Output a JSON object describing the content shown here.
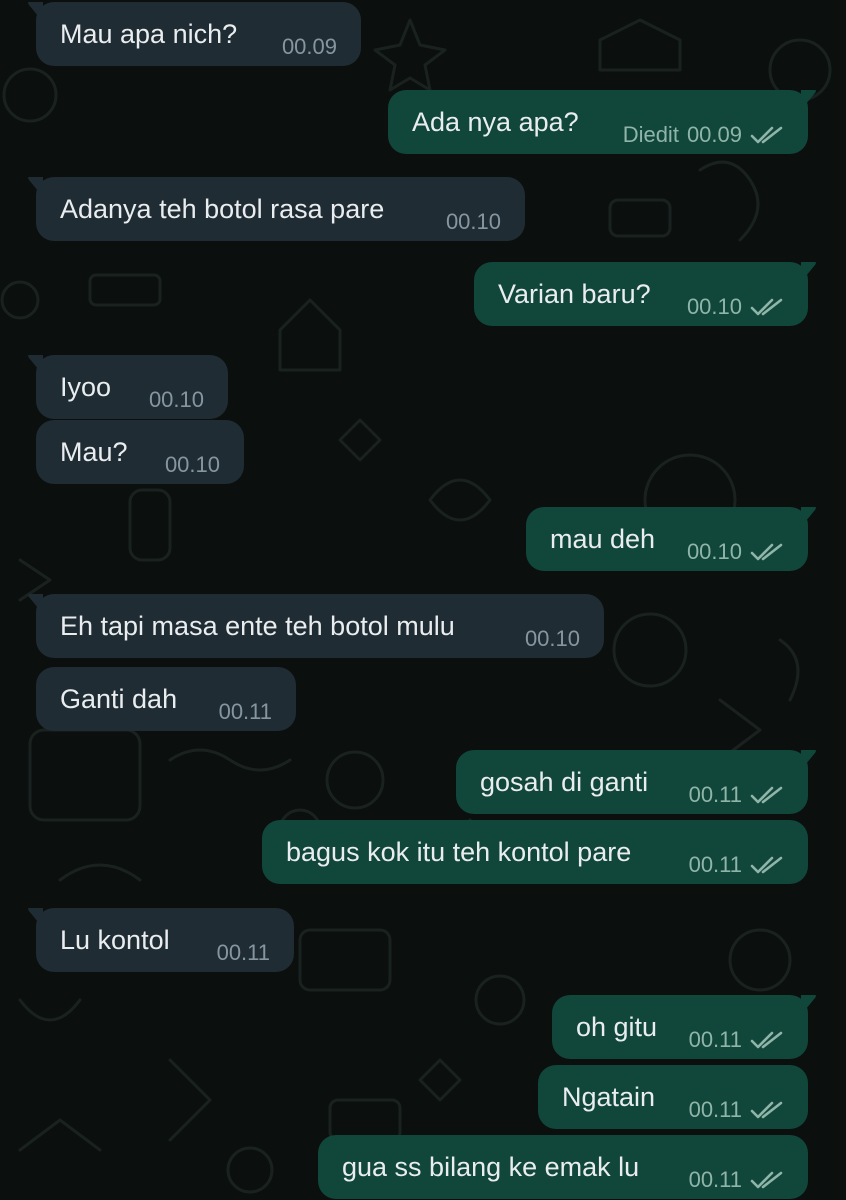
{
  "colors": {
    "background": "#0b0f0e",
    "incoming_bubble": "#202c33",
    "outgoing_bubble": "#11463a",
    "text": "#e9edef",
    "time_text": "#8696a0",
    "read_ticks": "#8fb5a8"
  },
  "icons": {
    "read_receipt": "double-check-icon"
  },
  "messages": [
    {
      "dir": "in",
      "text": "Mau apa nich?",
      "time": "00.09"
    },
    {
      "dir": "out",
      "text": "Ada nya apa?",
      "time": "00.09",
      "edited": "Diedit"
    },
    {
      "dir": "in",
      "text": "Adanya teh botol rasa pare",
      "time": "00.10"
    },
    {
      "dir": "out",
      "text": "Varian baru?",
      "time": "00.10"
    },
    {
      "dir": "in",
      "text": "Iyoo",
      "time": "00.10"
    },
    {
      "dir": "in",
      "text": "Mau?",
      "time": "00.10"
    },
    {
      "dir": "out",
      "text": "mau deh",
      "time": "00.10"
    },
    {
      "dir": "in",
      "text": "Eh tapi masa ente teh botol mulu",
      "time": "00.10"
    },
    {
      "dir": "in",
      "text": "Ganti dah",
      "time": "00.11"
    },
    {
      "dir": "out",
      "text": "gosah di ganti",
      "time": "00.11"
    },
    {
      "dir": "out",
      "text": "bagus kok itu teh kontol pare",
      "time": "00.11"
    },
    {
      "dir": "in",
      "text": "Lu kontol",
      "time": "00.11"
    },
    {
      "dir": "out",
      "text": "oh gitu",
      "time": "00.11"
    },
    {
      "dir": "out",
      "text": "Ngatain",
      "time": "00.11"
    },
    {
      "dir": "out",
      "text": "gua ss bilang ke emak lu",
      "time": "00.11"
    }
  ]
}
